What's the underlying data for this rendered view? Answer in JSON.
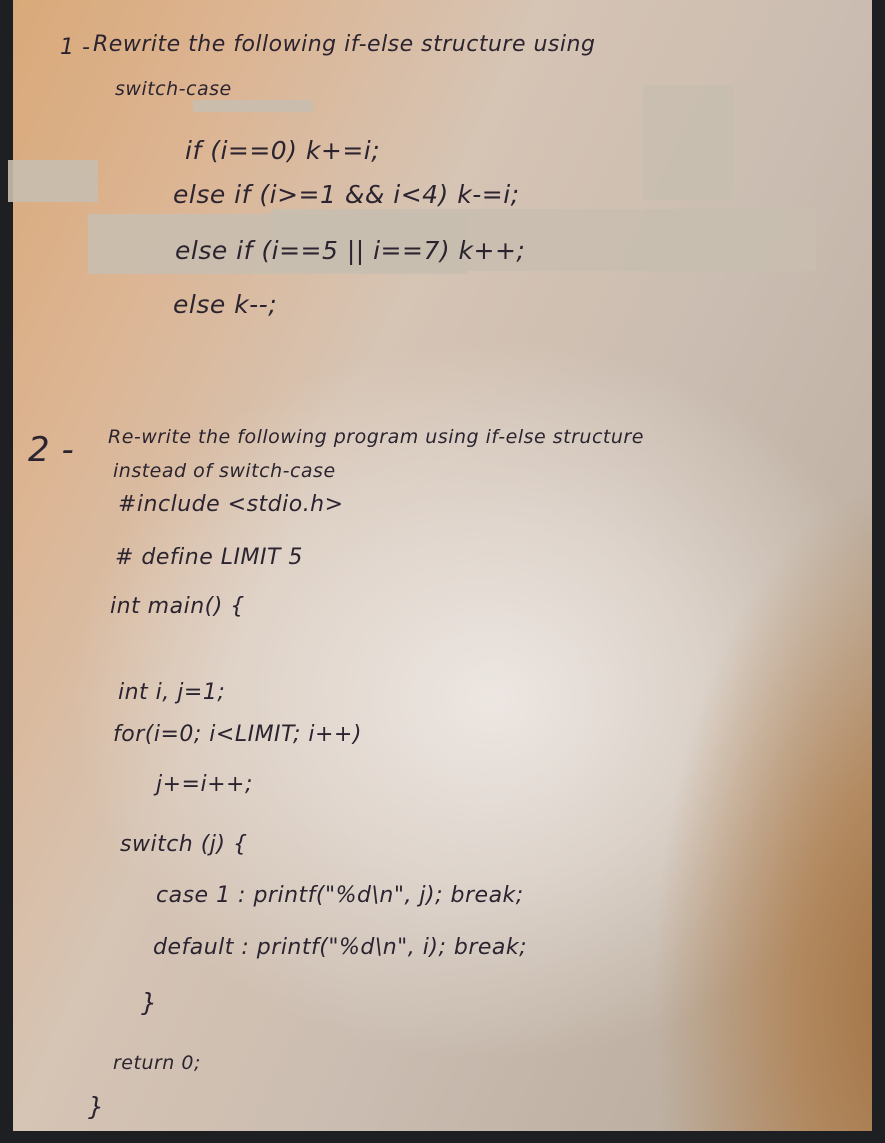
{
  "question1": {
    "number": "1 -",
    "title": "Rewrite the following if-else structure using",
    "subtitle": "switch-case",
    "code": [
      "if (i==0) k+=i;",
      "else if (i>=1 && i<4) k-=i;",
      "else if (i==5 || i==7) k++;",
      "else k--;"
    ]
  },
  "question2": {
    "number": "2 -",
    "title": "Re-write the following program using if-else structure",
    "subtitle": "instead of switch-case",
    "code": [
      "#include <stdio.h>",
      "# define  LIMIT 5",
      "int main() {",
      "int i, j=1;",
      "for(i=0; i<LIMIT; i++)",
      "j+=i++;",
      "switch (j) {",
      "case 1 : printf(\"%d\\n\", j); break;",
      "default : printf(\"%d\\n\", i); break;",
      "}",
      "return 0;",
      "}"
    ]
  },
  "colors": {
    "ink": "#2b2430",
    "border": "#1e1f22"
  }
}
